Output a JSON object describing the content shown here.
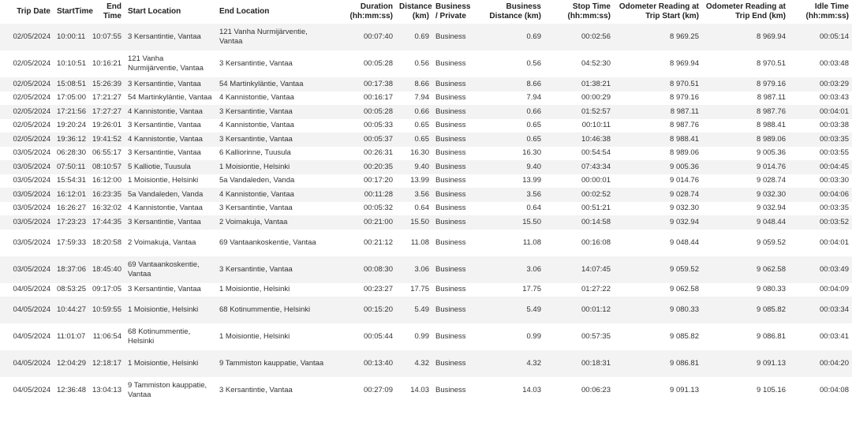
{
  "columns": [
    {
      "label": "Trip Date",
      "align": "r"
    },
    {
      "label": "StartTime",
      "align": "l"
    },
    {
      "label": "End Time",
      "align": "r"
    },
    {
      "label": "Start Location",
      "align": "l"
    },
    {
      "label": "End Location",
      "align": "l"
    },
    {
      "label": "Duration (hh:mm:ss)",
      "align": "r"
    },
    {
      "label": "Distance (km)",
      "align": "r"
    },
    {
      "label": "Business / Private",
      "align": "l"
    },
    {
      "label": "Business Distance (km)",
      "align": "r"
    },
    {
      "label": "Stop Time (hh:mm:ss)",
      "align": "r"
    },
    {
      "label": "Odometer Reading at Trip Start (km)",
      "align": "r"
    },
    {
      "label": "Odometer Reading at Trip End (km)",
      "align": "r"
    },
    {
      "label": "Idle Time (hh:mm:ss)",
      "align": "r"
    }
  ],
  "rows": [
    [
      "02/05/2024",
      "10:00:11",
      "10:07:55",
      "3 Kersantintie, Vantaa",
      "121 Vanha Nurmijärventie, Vantaa",
      "00:07:40",
      "0.69",
      "Business",
      "0.69",
      "00:02:56",
      "8 969.25",
      "8 969.94",
      "00:05:14"
    ],
    [
      "02/05/2024",
      "10:10:51",
      "10:16:21",
      "121 Vanha Nurmijärventie, Vantaa",
      "3 Kersantintie, Vantaa",
      "00:05:28",
      "0.56",
      "Business",
      "0.56",
      "04:52:30",
      "8 969.94",
      "8 970.51",
      "00:03:48"
    ],
    [
      "02/05/2024",
      "15:08:51",
      "15:26:39",
      "3 Kersantintie, Vantaa",
      "54 Martinkyläntie, Vantaa",
      "00:17:38",
      "8.66",
      "Business",
      "8.66",
      "01:38:21",
      "8 970.51",
      "8 979.16",
      "00:03:29"
    ],
    [
      "02/05/2024",
      "17:05:00",
      "17:21:27",
      "54 Martinkyläntie, Vantaa",
      "4 Kannistontie, Vantaa",
      "00:16:17",
      "7.94",
      "Business",
      "7.94",
      "00:00:29",
      "8 979.16",
      "8 987.11",
      "00:03:43"
    ],
    [
      "02/05/2024",
      "17:21:56",
      "17:27:27",
      "4 Kannistontie, Vantaa",
      "3 Kersantintie, Vantaa",
      "00:05:28",
      "0.66",
      "Business",
      "0.66",
      "01:52:57",
      "8 987.11",
      "8 987.76",
      "00:04:01"
    ],
    [
      "02/05/2024",
      "19:20:24",
      "19:26:01",
      "3 Kersantintie, Vantaa",
      "4 Kannistontie, Vantaa",
      "00:05:33",
      "0.65",
      "Business",
      "0.65",
      "00:10:11",
      "8 987.76",
      "8 988.41",
      "00:03:38"
    ],
    [
      "02/05/2024",
      "19:36:12",
      "19:41:52",
      "4 Kannistontie, Vantaa",
      "3 Kersantintie, Vantaa",
      "00:05:37",
      "0.65",
      "Business",
      "0.65",
      "10:46:38",
      "8 988.41",
      "8 989.06",
      "00:03:35"
    ],
    [
      "03/05/2024",
      "06:28:30",
      "06:55:17",
      "3 Kersantintie, Vantaa",
      "6 Kalliorinne, Tuusula",
      "00:26:31",
      "16.30",
      "Business",
      "16.30",
      "00:54:54",
      "8 989.06",
      "9 005.36",
      "00:03:55"
    ],
    [
      "03/05/2024",
      "07:50:11",
      "08:10:57",
      "5 Kalliotie, Tuusula",
      "1 Moisiontie, Helsinki",
      "00:20:35",
      "9.40",
      "Business",
      "9.40",
      "07:43:34",
      "9 005.36",
      "9 014.76",
      "00:04:45"
    ],
    [
      "03/05/2024",
      "15:54:31",
      "16:12:00",
      "1 Moisiontie, Helsinki",
      "5a Vandaleden, Vanda",
      "00:17:20",
      "13.99",
      "Business",
      "13.99",
      "00:00:01",
      "9 014.76",
      "9 028.74",
      "00:03:30"
    ],
    [
      "03/05/2024",
      "16:12:01",
      "16:23:35",
      "5a Vandaleden, Vanda",
      "4 Kannistontie, Vantaa",
      "00:11:28",
      "3.56",
      "Business",
      "3.56",
      "00:02:52",
      "9 028.74",
      "9 032.30",
      "00:04:06"
    ],
    [
      "03/05/2024",
      "16:26:27",
      "16:32:02",
      "4 Kannistontie, Vantaa",
      "3 Kersantintie, Vantaa",
      "00:05:32",
      "0.64",
      "Business",
      "0.64",
      "00:51:21",
      "9 032.30",
      "9 032.94",
      "00:03:35"
    ],
    [
      "03/05/2024",
      "17:23:23",
      "17:44:35",
      "3 Kersantintie, Vantaa",
      "2 Voimakuja, Vantaa",
      "00:21:00",
      "15.50",
      "Business",
      "15.50",
      "00:14:58",
      "9 032.94",
      "9 048.44",
      "00:03:52"
    ],
    [
      "03/05/2024",
      "17:59:33",
      "18:20:58",
      "2 Voimakuja, Vantaa",
      "69 Vantaankoskentie, Vantaa",
      "00:21:12",
      "11.08",
      "Business",
      "11.08",
      "00:16:08",
      "9 048.44",
      "9 059.52",
      "00:04:01"
    ],
    [
      "03/05/2024",
      "18:37:06",
      "18:45:40",
      "69 Vantaankoskentie, Vantaa",
      "3 Kersantintie, Vantaa",
      "00:08:30",
      "3.06",
      "Business",
      "3.06",
      "14:07:45",
      "9 059.52",
      "9 062.58",
      "00:03:49"
    ],
    [
      "04/05/2024",
      "08:53:25",
      "09:17:05",
      "3 Kersantintie, Vantaa",
      "1 Moisiontie, Helsinki",
      "00:23:27",
      "17.75",
      "Business",
      "17.75",
      "01:27:22",
      "9 062.58",
      "9 080.33",
      "00:04:09"
    ],
    [
      "04/05/2024",
      "10:44:27",
      "10:59:55",
      "1 Moisiontie, Helsinki",
      "68 Kotinummentie, Helsinki",
      "00:15:20",
      "5.49",
      "Business",
      "5.49",
      "00:01:12",
      "9 080.33",
      "9 085.82",
      "00:03:34"
    ],
    [
      "04/05/2024",
      "11:01:07",
      "11:06:54",
      "68 Kotinummentie, Helsinki",
      "1 Moisiontie, Helsinki",
      "00:05:44",
      "0.99",
      "Business",
      "0.99",
      "00:57:35",
      "9 085.82",
      "9 086.81",
      "00:03:41"
    ],
    [
      "04/05/2024",
      "12:04:29",
      "12:18:17",
      "1 Moisiontie, Helsinki",
      "9 Tammiston kauppatie, Vantaa",
      "00:13:40",
      "4.32",
      "Business",
      "4.32",
      "00:18:31",
      "9 086.81",
      "9 091.13",
      "00:04:20"
    ],
    [
      "04/05/2024",
      "12:36:48",
      "13:04:13",
      "9 Tammiston kauppatie, Vantaa",
      "3 Kersantintie, Vantaa",
      "00:27:09",
      "14.03",
      "Business",
      "14.03",
      "00:06:23",
      "9 091.13",
      "9 105.16",
      "00:04:08"
    ]
  ]
}
